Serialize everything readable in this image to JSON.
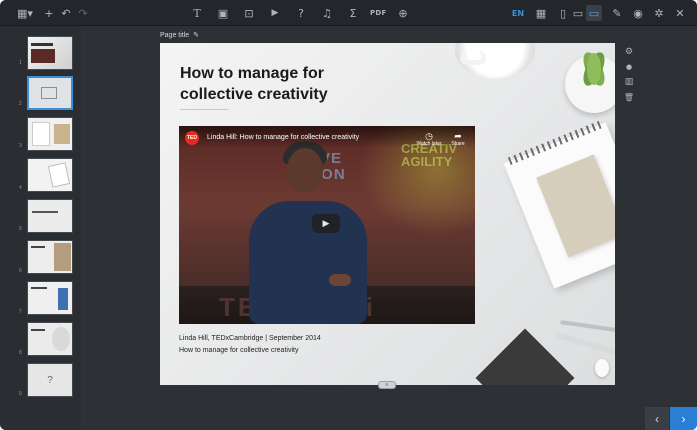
{
  "toolbar": {
    "left": [
      {
        "name": "slides-menu-icon",
        "glyph": "▦▾"
      },
      {
        "name": "add-icon",
        "glyph": "+"
      },
      {
        "name": "undo-icon",
        "glyph": "↶"
      },
      {
        "name": "redo-icon",
        "glyph": "↷"
      }
    ],
    "center": [
      {
        "name": "text-icon",
        "glyph": "T"
      },
      {
        "name": "image-icon",
        "glyph": "▣"
      },
      {
        "name": "caption-icon",
        "glyph": "⊡"
      },
      {
        "name": "video-icon",
        "glyph": "▶"
      },
      {
        "name": "question-icon",
        "glyph": "?"
      },
      {
        "name": "audio-icon",
        "glyph": "♫"
      },
      {
        "name": "formula-icon",
        "glyph": "Σ"
      },
      {
        "name": "pdf-icon",
        "glyph": "PDF"
      },
      {
        "name": "embed-icon",
        "glyph": "⊕"
      }
    ],
    "language": "EN",
    "right": [
      {
        "name": "table-icon",
        "glyph": "▦"
      },
      {
        "name": "mobile-view-icon",
        "glyph": "▯"
      },
      {
        "name": "tablet-view-icon",
        "glyph": "▭"
      },
      {
        "name": "desktop-view-icon",
        "glyph": "▭"
      },
      {
        "name": "theme-brush-icon",
        "glyph": "✎"
      },
      {
        "name": "preview-eye-icon",
        "glyph": "◉"
      },
      {
        "name": "settings-gear-icon",
        "glyph": "✲"
      },
      {
        "name": "close-icon",
        "glyph": "✕"
      }
    ]
  },
  "rail": {
    "thumbnails": [
      {
        "num": "1",
        "label": ""
      },
      {
        "num": "2",
        "label": ""
      },
      {
        "num": "3",
        "label": ""
      },
      {
        "num": "4",
        "label": ""
      },
      {
        "num": "5",
        "label": ""
      },
      {
        "num": "6",
        "label": ""
      },
      {
        "num": "7",
        "label": ""
      },
      {
        "num": "8",
        "label": ""
      },
      {
        "num": "9",
        "label": "?"
      }
    ],
    "selected_index": 1
  },
  "page": {
    "title": "Page title",
    "pencil": "✎"
  },
  "slide": {
    "heading_line1": "How to manage for",
    "heading_line2": "collective creativity",
    "video": {
      "logo": "TED",
      "title": "Linda Hill: How to manage for collective creativity",
      "watch_later": "Watch later",
      "share": "Share",
      "play": "▶",
      "stage_text_1": "ATIVE",
      "stage_text_2": "UTION",
      "agility_1": "CREATIV",
      "agility_2": "AGILITY",
      "floor_text": "TEDx mbri"
    },
    "caption_line1": "Linda Hill, TEDxCambridge | September 2014",
    "caption_line2": "How to manage for collective creativity",
    "handle": "≡"
  },
  "slide_tools": [
    {
      "name": "settings-icon",
      "glyph": "⚙"
    },
    {
      "name": "color-drop-icon",
      "glyph": "●"
    },
    {
      "name": "chart-icon",
      "glyph": "▥"
    },
    {
      "name": "trash-icon",
      "glyph": "🗑"
    }
  ],
  "nav": {
    "prev": "‹",
    "next": "›"
  }
}
